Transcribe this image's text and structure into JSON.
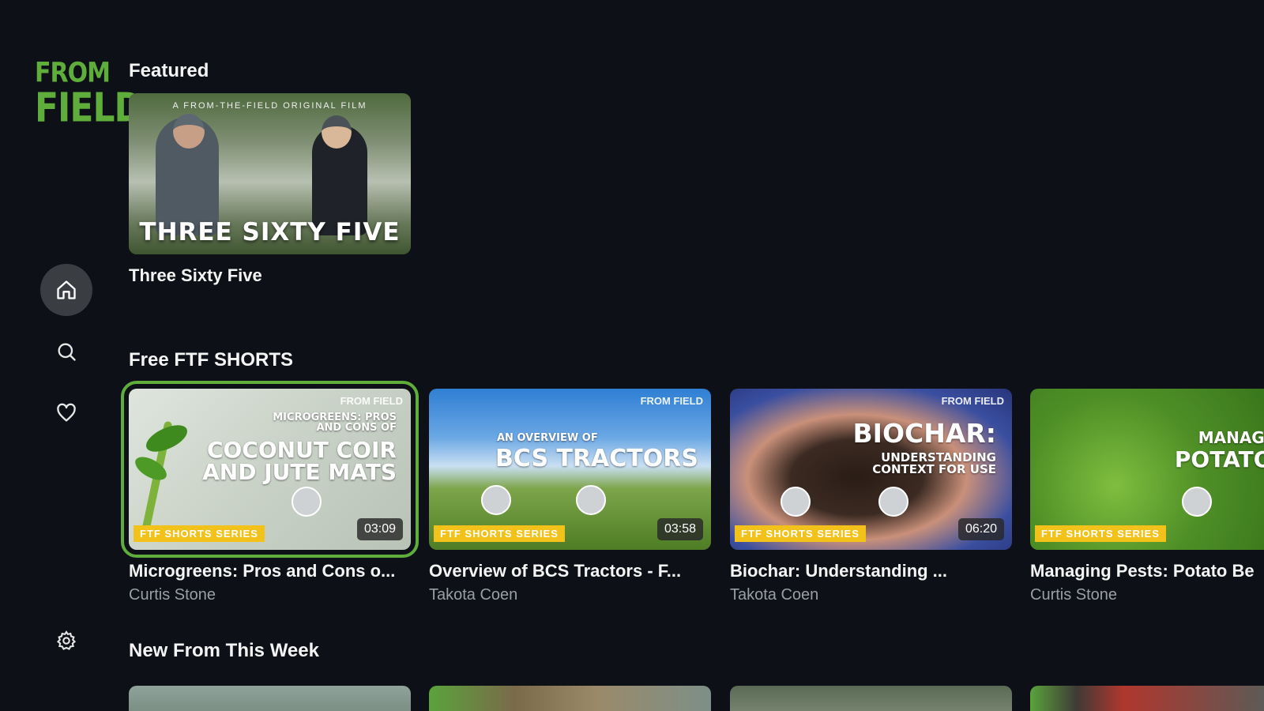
{
  "brand": {
    "logo_line1": "FROM",
    "logo_line2": "FIELD"
  },
  "sidebar": {
    "items": [
      {
        "name": "home",
        "icon": "home-icon",
        "active": true
      },
      {
        "name": "search",
        "icon": "search-icon",
        "active": false
      },
      {
        "name": "favorites",
        "icon": "heart-icon",
        "active": false
      },
      {
        "name": "settings",
        "icon": "gear-icon",
        "active": false
      }
    ]
  },
  "featured": {
    "section_title": "Featured",
    "items": [
      {
        "title": "Three Sixty Five",
        "thumb_top_text": "A FROM-THE-FIELD ORIGINAL FILM",
        "thumb_main_text": "THREE SIXTY FIVE"
      }
    ]
  },
  "shorts": {
    "section_title": "Free FTF SHORTS",
    "items": [
      {
        "title": "Microgreens: Pros and Cons o...",
        "author": "Curtis Stone",
        "duration": "03:09",
        "badge": "FTF SHORTS SERIES",
        "brandmark": "FROM FIELD",
        "overlay_small": "MICROGREENS: PROS AND CONS OF",
        "overlay_big": "COCONUT COIR AND JUTE MATS"
      },
      {
        "title": "Overview of BCS Tractors - F...",
        "author": "Takota Coen",
        "duration": "03:58",
        "badge": "FTF SHORTS SERIES",
        "brandmark": "FROM FIELD",
        "overlay_small": "AN OVERVIEW OF",
        "overlay_big": "BCS TRACTORS"
      },
      {
        "title": "Biochar: Understanding ...",
        "author": "Takota Coen",
        "duration": "06:20",
        "badge": "FTF SHORTS SERIES",
        "brandmark": "FROM FIELD",
        "overlay_small": "UNDERSTANDING CONTEXT FOR USE",
        "overlay_big": "BIOCHAR:"
      },
      {
        "title": "Managing Pests: Potato Be",
        "author": "Curtis Stone",
        "duration": "",
        "badge": "FTF SHORTS SERIES",
        "brandmark": "",
        "overlay_small": "MANAGING PES",
        "overlay_big": "POTATO BEET"
      }
    ]
  },
  "new_this_week": {
    "section_title": "New From This Week"
  },
  "colors": {
    "background": "#0d1117",
    "accent_green": "#5fae3b",
    "badge_yellow": "#f2c21b"
  }
}
